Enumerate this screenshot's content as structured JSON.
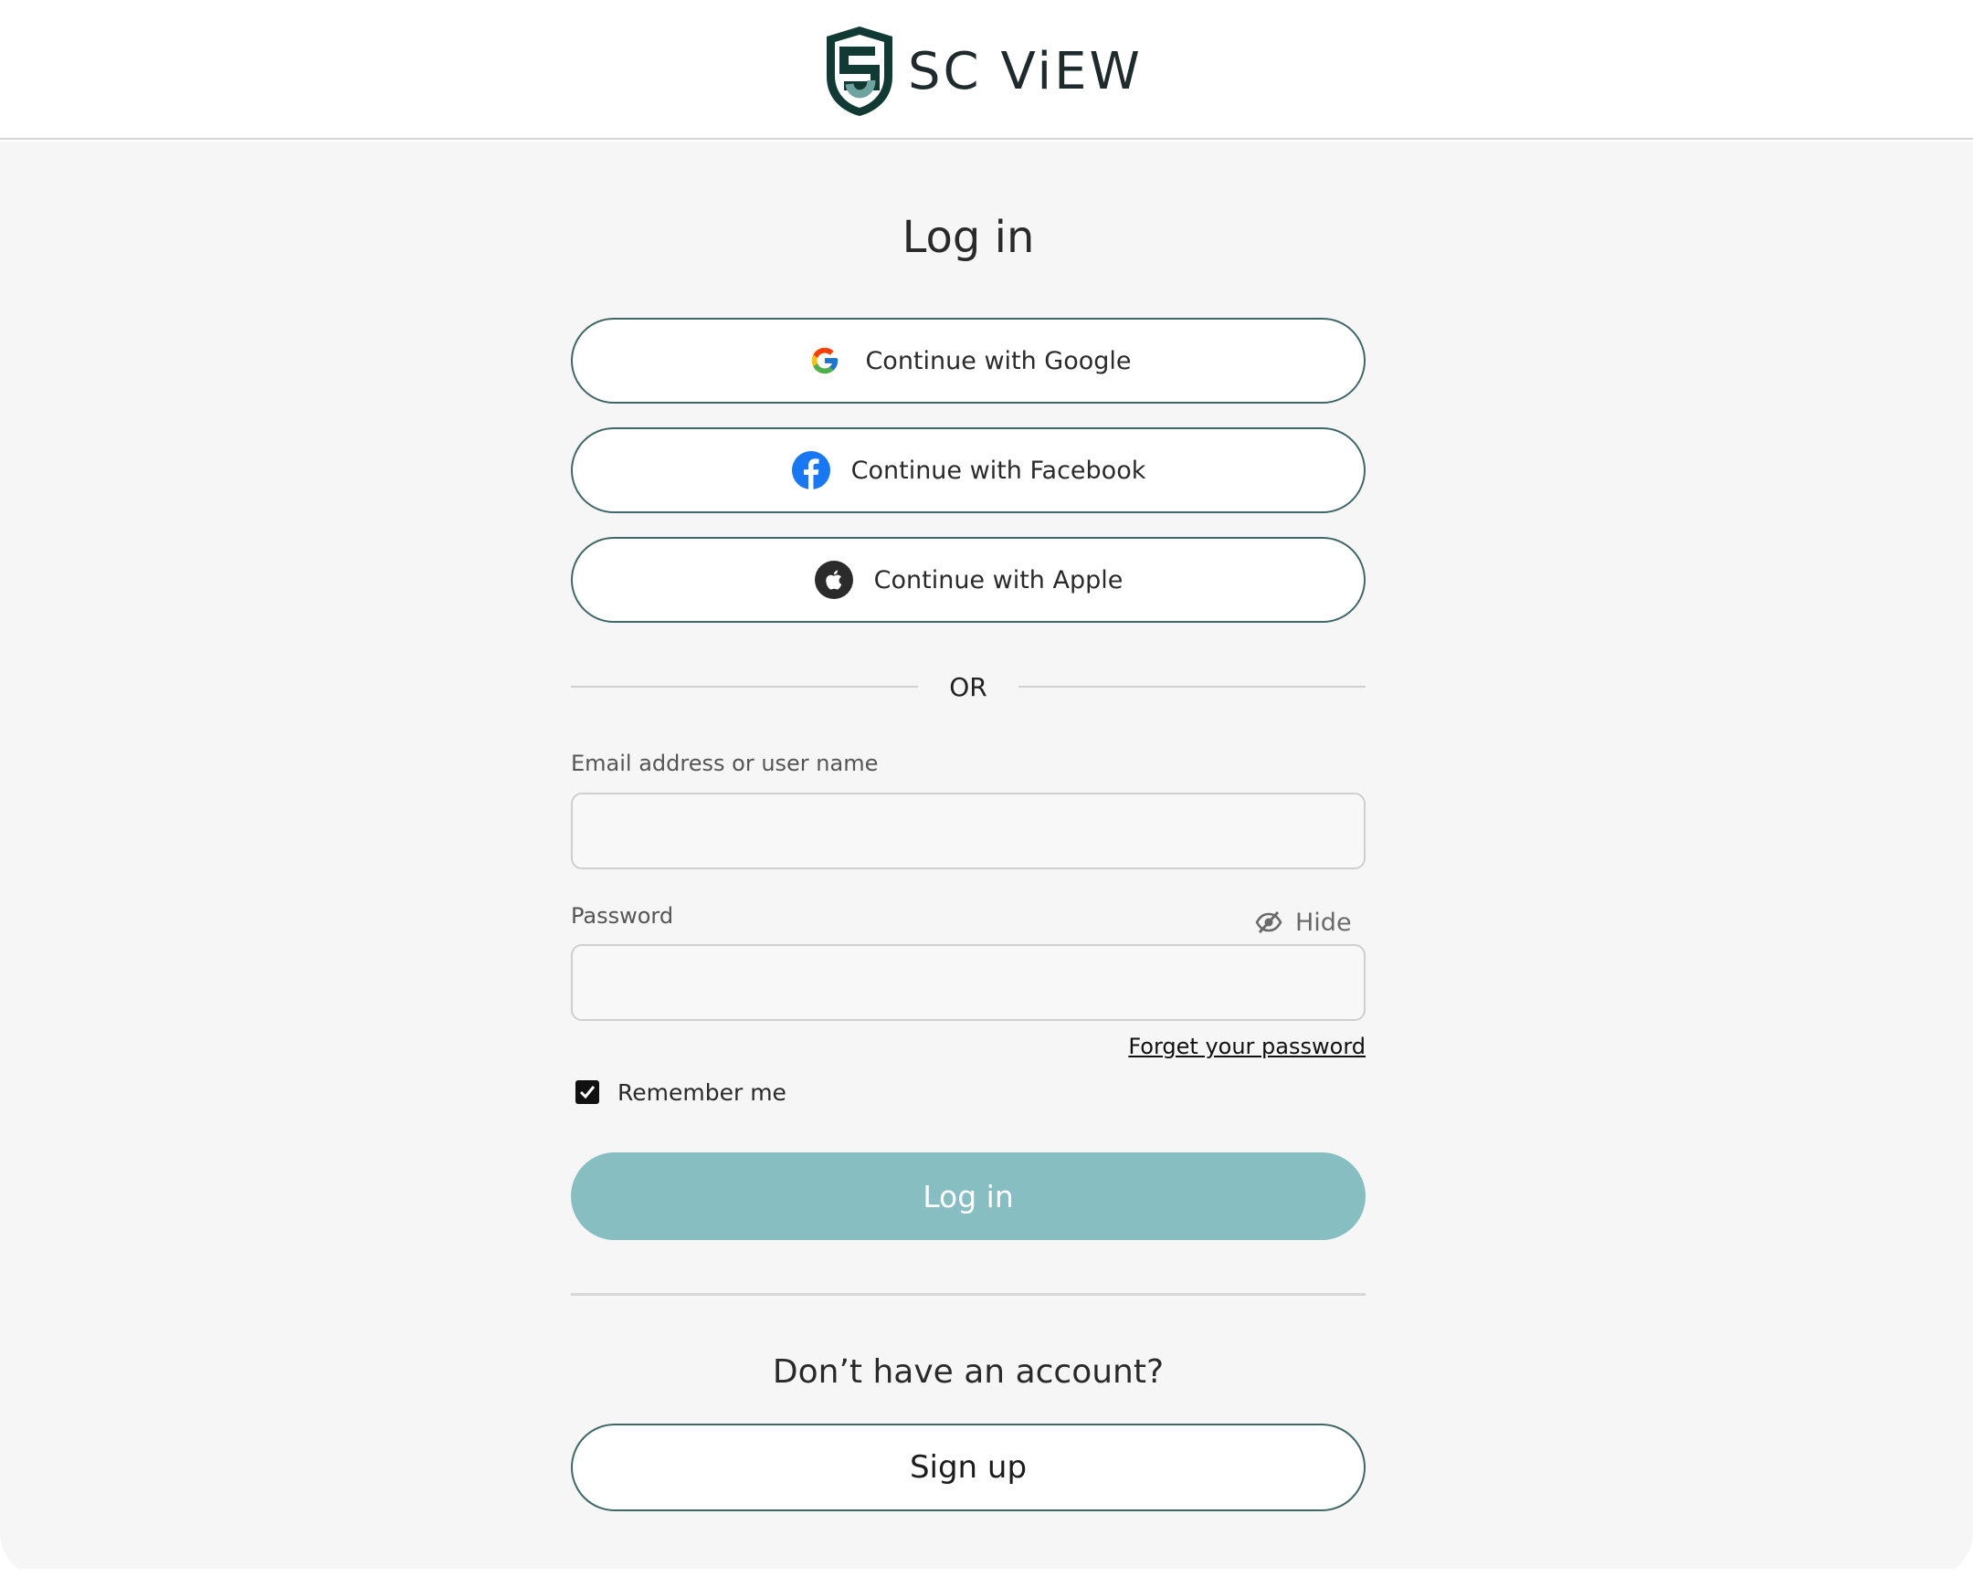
{
  "header": {
    "logo_text": "SC ViEW"
  },
  "login": {
    "title": "Log in",
    "oauth": {
      "google_label": "Continue with Google",
      "facebook_label": "Continue with Facebook",
      "apple_label": "Continue with Apple"
    },
    "divider_text": "OR",
    "email": {
      "label": "Email address or user name",
      "value": "",
      "placeholder": ""
    },
    "password": {
      "label": "Password",
      "value": "",
      "placeholder": "",
      "toggle_label": "Hide"
    },
    "forgot_label": "Forget your password",
    "remember": {
      "label": "Remember me",
      "checked": true
    },
    "submit_label": "Log in"
  },
  "signup": {
    "prompt": "Don’t have an account?",
    "button_label": "Sign up"
  },
  "colors": {
    "accent_teal": "#86bec1",
    "button_border": "#3f6764",
    "logo_dark": "#103a33",
    "facebook_blue": "#1877f2",
    "background": "#f6f6f6"
  },
  "icons": [
    "shield-logo-icon",
    "google-icon",
    "facebook-icon",
    "apple-icon",
    "eye-slash-icon",
    "check-icon"
  ]
}
